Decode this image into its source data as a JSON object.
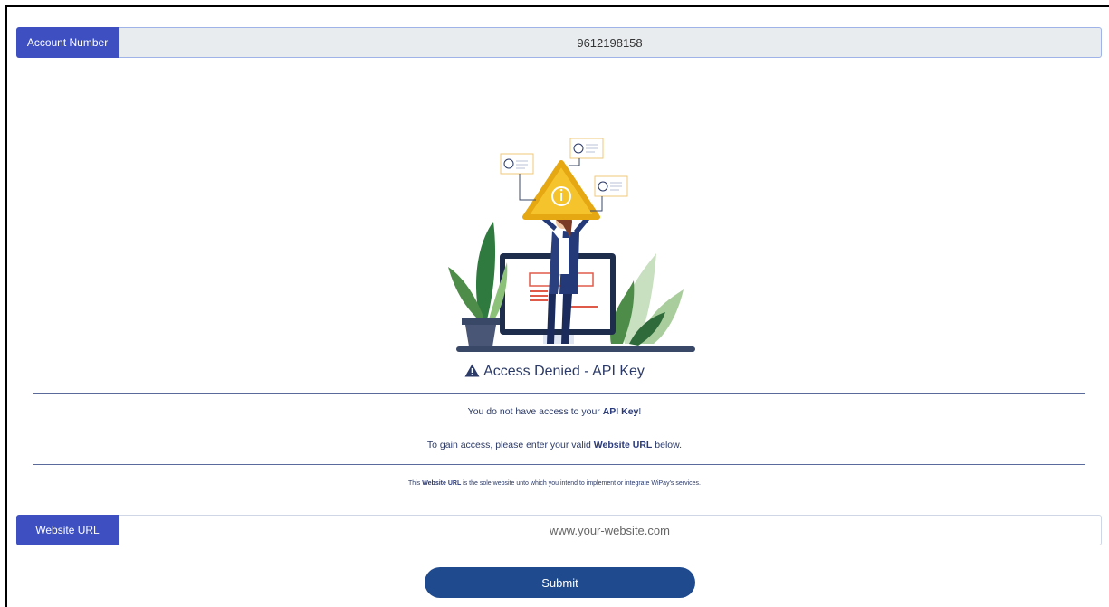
{
  "account": {
    "label": "Account Number",
    "value": "9612198158"
  },
  "notice": {
    "title": "Access Denied - API Key",
    "icon": "warning-triangle-icon",
    "line1_prefix": "You do not have access to your ",
    "line1_bold": "API Key",
    "line1_suffix": "!",
    "line2_prefix": "To gain access, please enter your valid ",
    "line2_bold": "Website URL",
    "line2_suffix": " below.",
    "note_prefix": "This ",
    "note_bold": "Website URL",
    "note_suffix": " is the sole website unto which you intend to implement or integrate WiPay's services."
  },
  "website": {
    "label": "Website URL",
    "placeholder": "www.your-website.com"
  },
  "submit_label": "Submit",
  "colors": {
    "addon_bg": "#3d4fc1",
    "submit_bg": "#1f4b8e",
    "text": "#2b3a67",
    "warning_yellow": "#f5c32c"
  }
}
